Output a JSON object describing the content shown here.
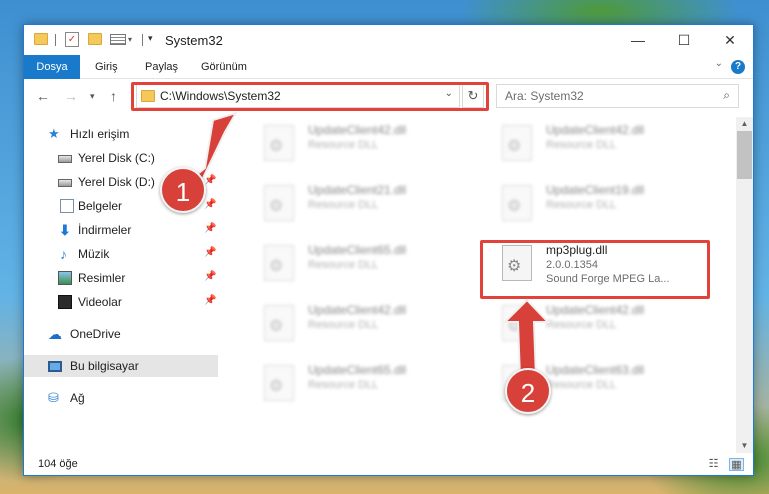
{
  "window": {
    "title": "System32",
    "controls": {
      "minimize": "—",
      "maximize": "☐",
      "close": "✕"
    }
  },
  "ribbon": {
    "tabs": [
      "Dosya",
      "Giriş",
      "Paylaş",
      "Görünüm"
    ],
    "help": "?"
  },
  "navbar": {
    "address": "C:\\Windows\\System32",
    "search_placeholder": "Ara: System32"
  },
  "sidebar": {
    "items": [
      {
        "label": "Hızlı erişim",
        "icon": "star-icon"
      },
      {
        "label": "Yerel Disk (C:)",
        "icon": "disk-icon",
        "pinned": true
      },
      {
        "label": "Yerel Disk (D:)",
        "icon": "disk-icon",
        "pinned": true
      },
      {
        "label": "Belgeler",
        "icon": "documents-icon",
        "pinned": true
      },
      {
        "label": "İndirmeler",
        "icon": "download-icon",
        "pinned": true
      },
      {
        "label": "Müzik",
        "icon": "music-icon",
        "pinned": true
      },
      {
        "label": "Resimler",
        "icon": "pictures-icon",
        "pinned": true
      },
      {
        "label": "Videolar",
        "icon": "videos-icon",
        "pinned": true
      },
      {
        "label": "OneDrive",
        "icon": "cloud-icon"
      },
      {
        "label": "Bu bilgisayar",
        "icon": "computer-icon",
        "selected": true
      },
      {
        "label": "Ağ",
        "icon": "network-icon"
      }
    ]
  },
  "files": [
    {
      "name": "UpdateClient42.dll",
      "desc": "Resource DLL"
    },
    {
      "name": "UpdateClient42.dll",
      "desc": "Resource DLL"
    },
    {
      "name": "UpdateClient21.dll",
      "desc": "Resource DLL"
    },
    {
      "name": "UpdateClient19.dll",
      "desc": "Resource DLL"
    },
    {
      "name": "UpdateClient65.dll",
      "desc": "Resource DLL"
    },
    {
      "name": "mp3plug.dll",
      "version": "2.0.0.1354",
      "desc": "Sound Forge MPEG La..."
    },
    {
      "name": "UpdateClient42.dll",
      "desc": "Resource DLL"
    },
    {
      "name": "UpdateClient42.dll",
      "desc": "Resource DLL"
    },
    {
      "name": "UpdateClient65.dll",
      "desc": "Resource DLL"
    },
    {
      "name": "UpdateClient63.dll",
      "desc": "Resource DLL"
    }
  ],
  "status": {
    "count": "104 öğe"
  },
  "callouts": [
    "1",
    "2"
  ],
  "colors": {
    "accent": "#1979ca",
    "highlight": "#e2423a"
  }
}
